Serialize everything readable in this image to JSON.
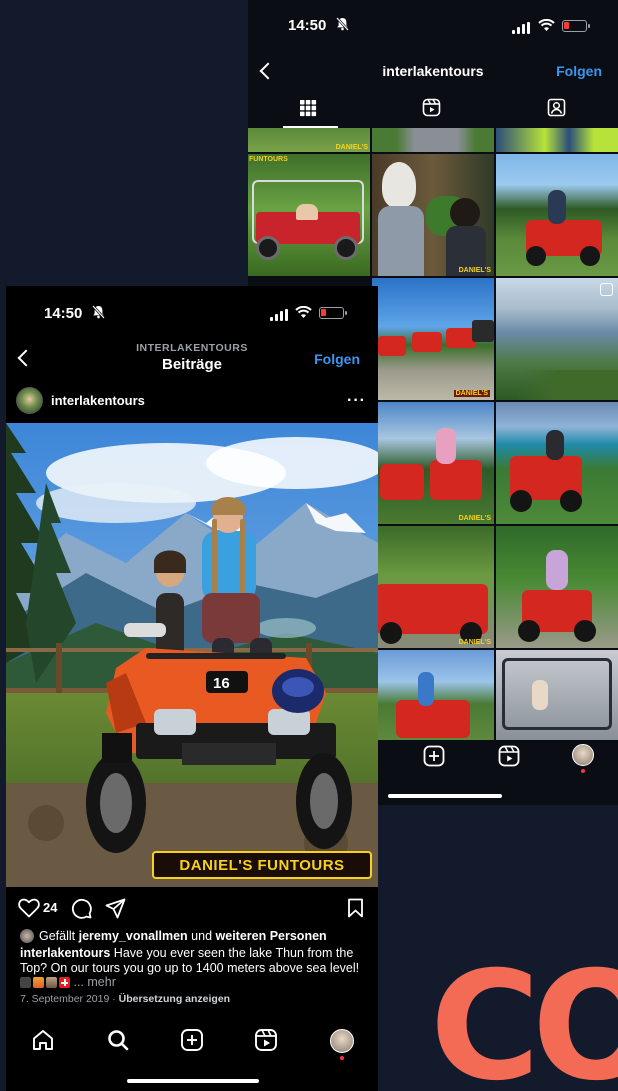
{
  "back_phone": {
    "status_time": "14:50",
    "username_title": "interlakentours",
    "follow_label": "Folgen",
    "tabs": [
      "grid",
      "reels",
      "tagged"
    ],
    "grid_watermark": "DANIEL'S",
    "grid_corner_text": "FUNTOURS"
  },
  "front_phone": {
    "status_time": "14:50",
    "nav_small": "INTERLAKENTOURS",
    "nav_title": "Beiträge",
    "follow_label": "Folgen",
    "post_username": "interlakentours",
    "photo_watermark": "DANIEL'S FUNTOURS",
    "quad_number": "16",
    "likes_count": "24",
    "liked_by_prefix": "Gefällt ",
    "liked_by_user": "jeremy_vonallmen",
    "liked_by_mid": " und ",
    "liked_by_rest": "weiteren Personen",
    "caption_user": "interlakentours",
    "caption_text": " Have you ever seen the lake Thun from the Top? On our tours you go up to 1400 meters above sea level!",
    "caption_more": "... mehr",
    "post_date": "7. September 2019",
    "meta_sep": " · ",
    "translate_label": "Übersetzung anzeigen"
  },
  "colors": {
    "accent_blue": "#3897f0",
    "brand_coral": "#f36b55",
    "background": "#121a2b"
  }
}
